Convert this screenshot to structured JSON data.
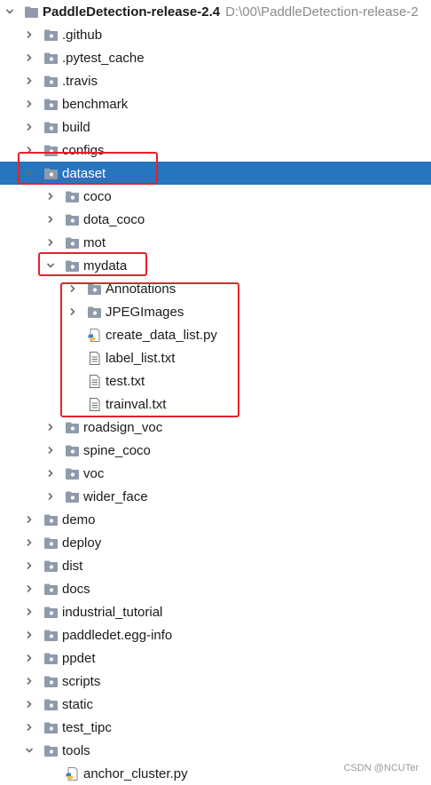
{
  "root": {
    "name": "PaddleDetection-release-2.4",
    "path": "D:\\00\\PaddleDetection-release-2"
  },
  "items": [
    {
      "label": ".github",
      "depth": 1,
      "type": "folder",
      "expanded": false
    },
    {
      "label": ".pytest_cache",
      "depth": 1,
      "type": "folder",
      "expanded": false
    },
    {
      "label": ".travis",
      "depth": 1,
      "type": "folder",
      "expanded": false
    },
    {
      "label": "benchmark",
      "depth": 1,
      "type": "folder",
      "expanded": false
    },
    {
      "label": "build",
      "depth": 1,
      "type": "folder",
      "expanded": false
    },
    {
      "label": "configs",
      "depth": 1,
      "type": "folder",
      "expanded": false
    },
    {
      "label": "dataset",
      "depth": 1,
      "type": "folder",
      "expanded": true,
      "selected": true
    },
    {
      "label": "coco",
      "depth": 2,
      "type": "folder",
      "expanded": false
    },
    {
      "label": "dota_coco",
      "depth": 2,
      "type": "folder",
      "expanded": false
    },
    {
      "label": "mot",
      "depth": 2,
      "type": "folder",
      "expanded": false
    },
    {
      "label": "mydata",
      "depth": 2,
      "type": "folder",
      "expanded": true
    },
    {
      "label": "Annotations",
      "depth": 3,
      "type": "folder",
      "expanded": false
    },
    {
      "label": "JPEGImages",
      "depth": 3,
      "type": "folder",
      "expanded": false
    },
    {
      "label": "create_data_list.py",
      "depth": 3,
      "type": "python"
    },
    {
      "label": "label_list.txt",
      "depth": 3,
      "type": "text"
    },
    {
      "label": "test.txt",
      "depth": 3,
      "type": "text"
    },
    {
      "label": "trainval.txt",
      "depth": 3,
      "type": "text"
    },
    {
      "label": "roadsign_voc",
      "depth": 2,
      "type": "folder",
      "expanded": false
    },
    {
      "label": "spine_coco",
      "depth": 2,
      "type": "folder",
      "expanded": false
    },
    {
      "label": "voc",
      "depth": 2,
      "type": "folder",
      "expanded": false
    },
    {
      "label": "wider_face",
      "depth": 2,
      "type": "folder",
      "expanded": false
    },
    {
      "label": "demo",
      "depth": 1,
      "type": "folder",
      "expanded": false
    },
    {
      "label": "deploy",
      "depth": 1,
      "type": "folder",
      "expanded": false
    },
    {
      "label": "dist",
      "depth": 1,
      "type": "folder",
      "expanded": false
    },
    {
      "label": "docs",
      "depth": 1,
      "type": "folder",
      "expanded": false
    },
    {
      "label": "industrial_tutorial",
      "depth": 1,
      "type": "folder",
      "expanded": false
    },
    {
      "label": "paddledet.egg-info",
      "depth": 1,
      "type": "folder",
      "expanded": false
    },
    {
      "label": "ppdet",
      "depth": 1,
      "type": "folder",
      "expanded": false
    },
    {
      "label": "scripts",
      "depth": 1,
      "type": "folder",
      "expanded": false
    },
    {
      "label": "static",
      "depth": 1,
      "type": "folder",
      "expanded": false
    },
    {
      "label": "test_tipc",
      "depth": 1,
      "type": "folder",
      "expanded": false
    },
    {
      "label": "tools",
      "depth": 1,
      "type": "folder",
      "expanded": true
    },
    {
      "label": "anchor_cluster.py",
      "depth": 2,
      "type": "python"
    }
  ],
  "colors": {
    "selection": "#2675bf",
    "highlight_box": "#e8202a",
    "folder": "#8f9bab"
  },
  "watermark": "CSDN @NCUTer"
}
